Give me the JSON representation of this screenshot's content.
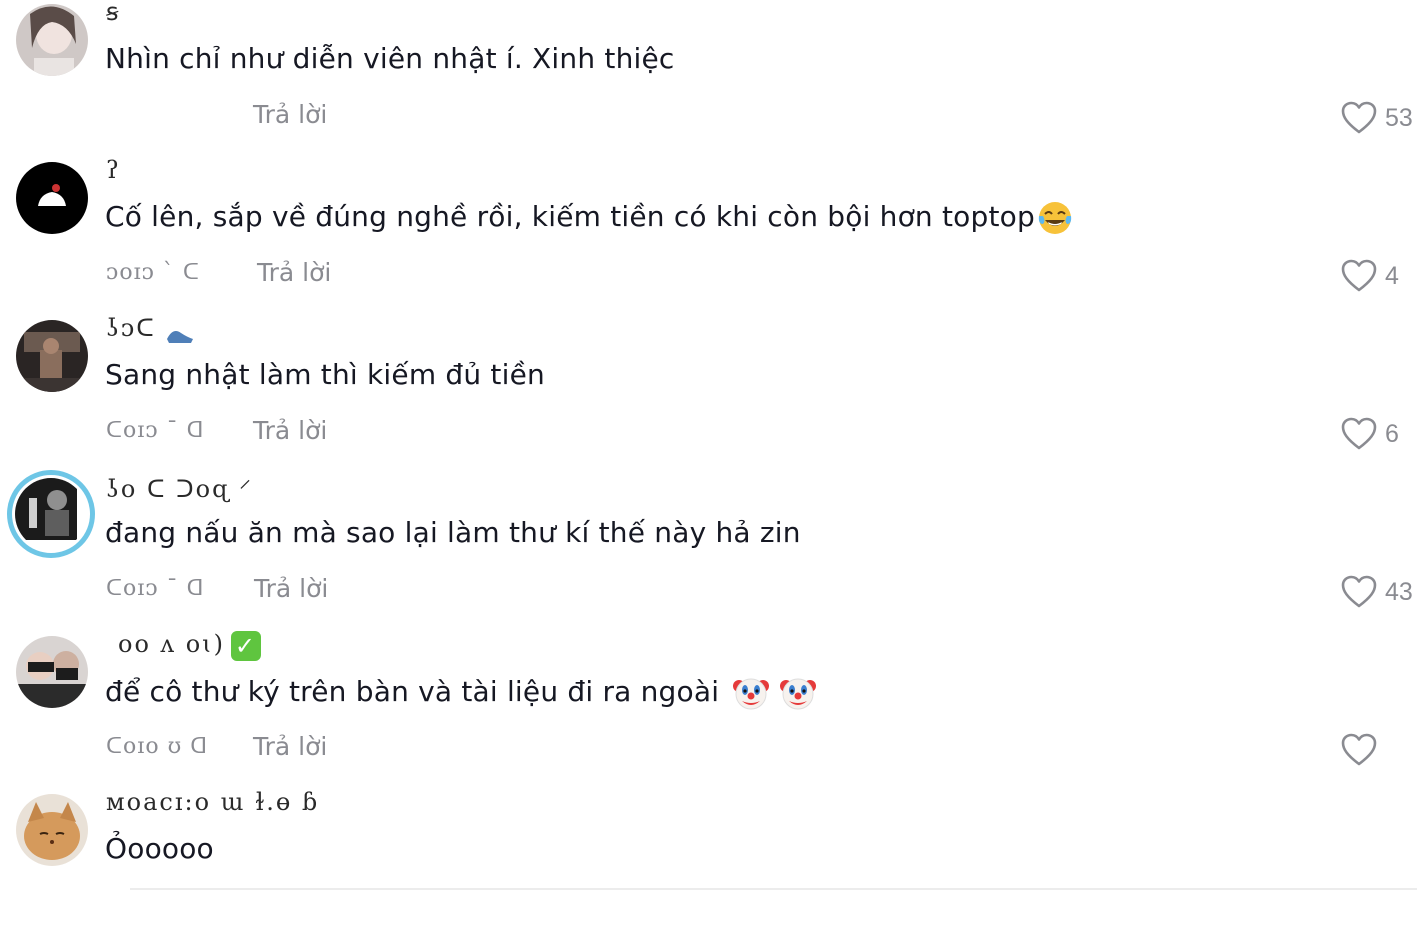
{
  "comments": [
    {
      "username": "ꞩ ",
      "text": "Nhìn chỉ như diễn viên nhật í. Xinh thiệc",
      "meta": "",
      "reply": "Trả lời",
      "likes": "53"
    },
    {
      "username": "ʔ",
      "text": "Cố lên, sắp về đúng nghề rồi, kiếm tiền có khi còn bội hơn toptop",
      "meta": "ᴐᴏɪᴐ ˋ ᑕ",
      "reply": "Trả lời",
      "likes": "4"
    },
    {
      "username": "ʖᴐᑕ",
      "text": "Sang nhật làm thì kiếm đủ tiền",
      "meta": "ᑕᴏɪᴐ ˉ ᗡ",
      "reply": "Trả lời",
      "likes": "6"
    },
    {
      "username": "ʖᴏ ᑕ ᑐᴏɋ ⸍",
      "text": "đang nấu ăn mà sao lại làm thư kí thế này hả zin",
      "meta": "ᑕᴏɪᴐ ˉ ᗡ",
      "reply": "Trả lời",
      "likes": "43"
    },
    {
      "username": "ᴏᴏ ᴧ ᴏɩ)",
      "text": "để cô thư ký trên bàn và tài liệu đi ra ngoài",
      "meta": "ᑕᴏɪᴏ ʊ ᗡ",
      "reply": "Trả lời",
      "likes": ""
    },
    {
      "username": "ᴍoacɪ:ᴏ ɯ ɫ.ɵ ɓ",
      "text": "Ỏooooo",
      "meta": "",
      "reply": "",
      "likes": ""
    }
  ],
  "icons": {
    "like": "heart-outline-icon",
    "laugh": "tears-of-joy-emoji",
    "clown": "clown-face-emoji",
    "check": "check-mark-button-emoji"
  }
}
